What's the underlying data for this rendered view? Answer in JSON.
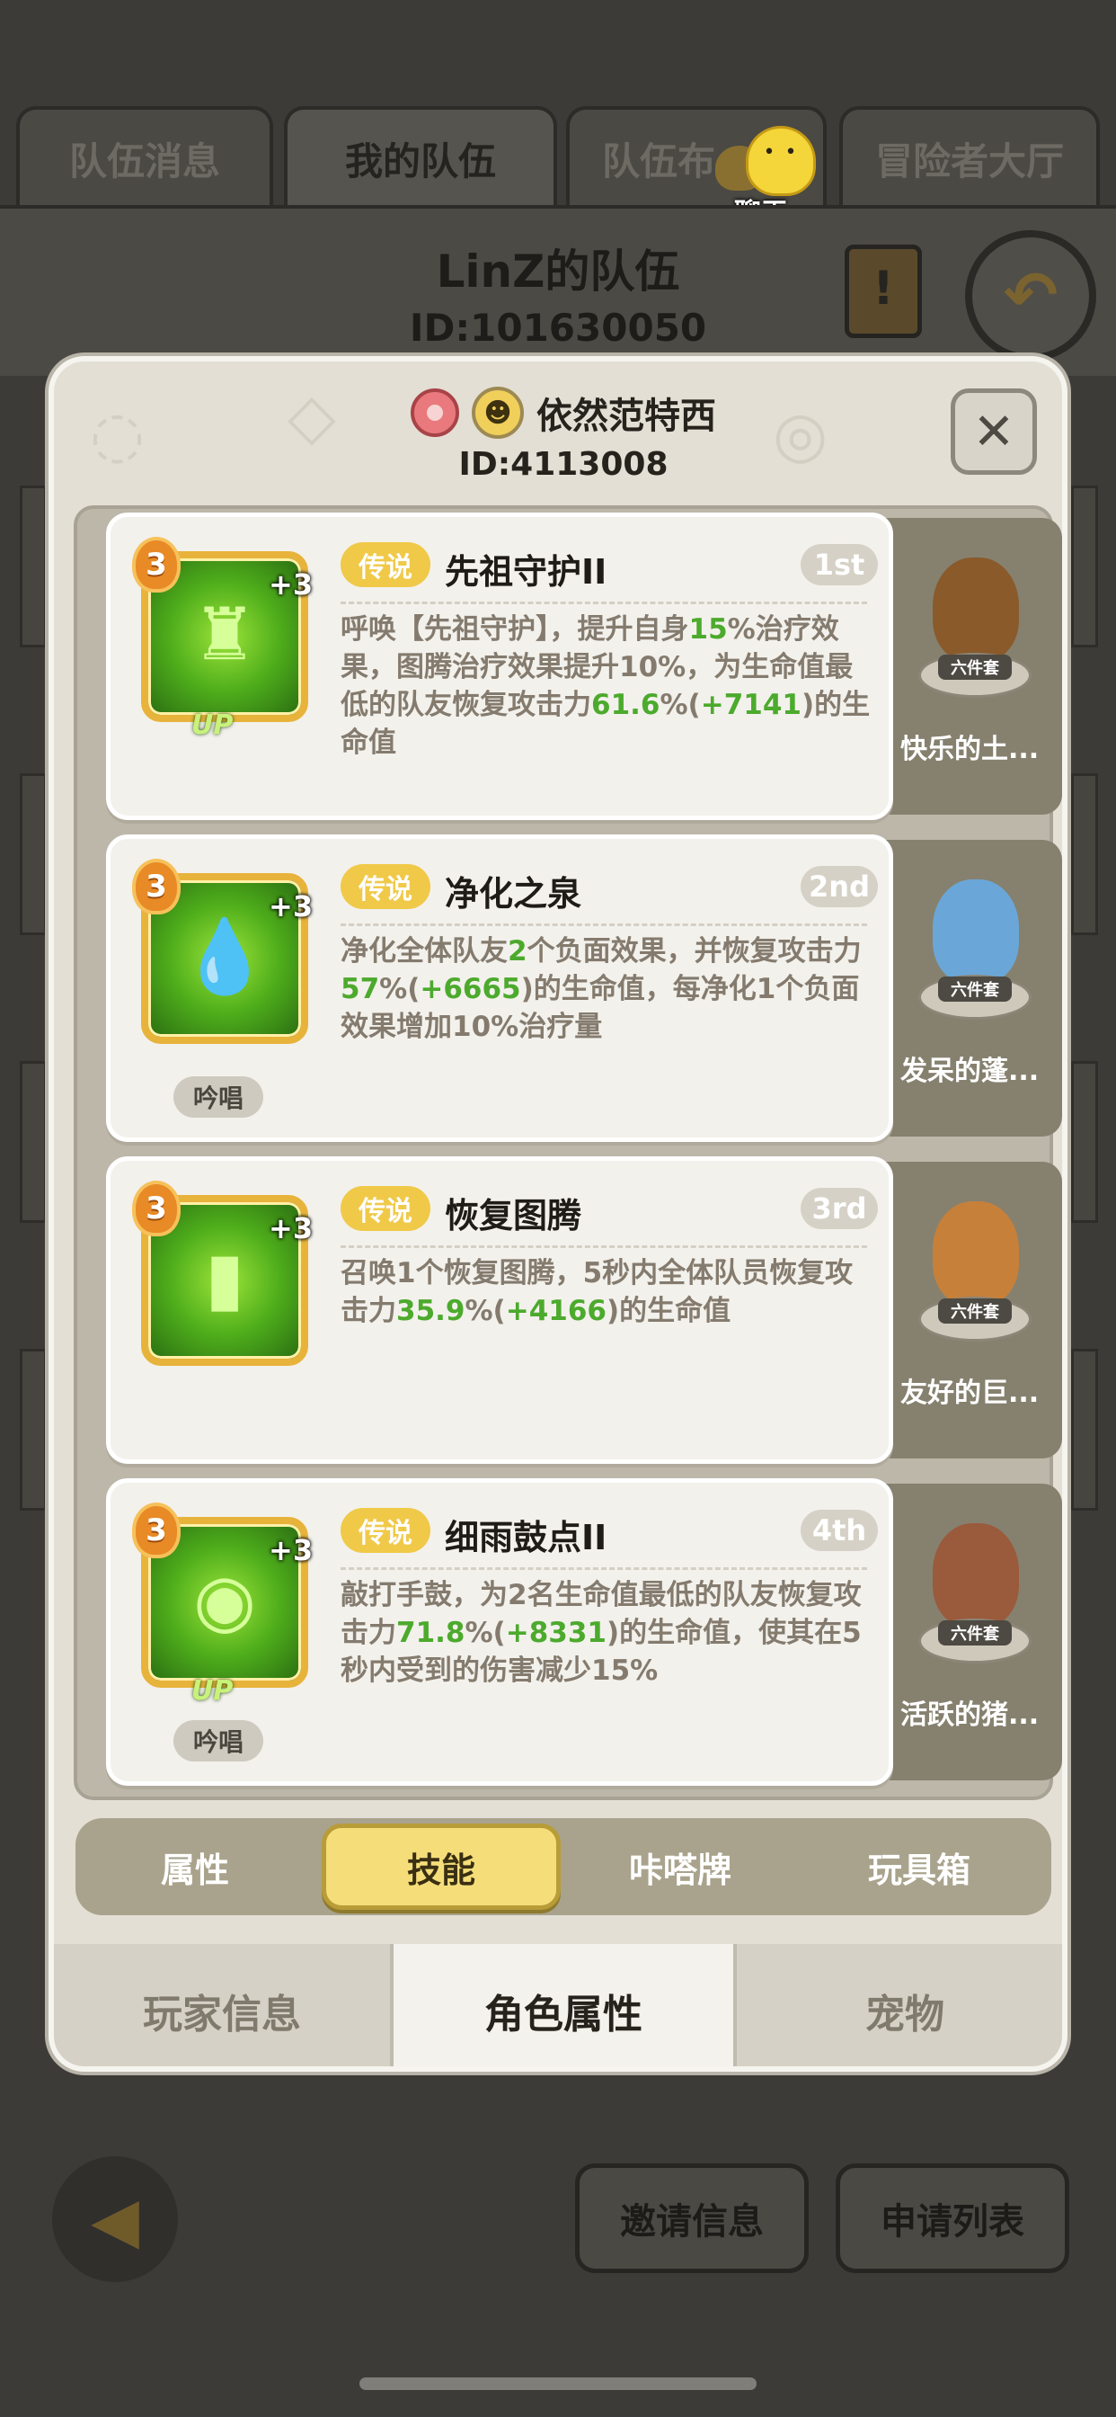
{
  "top_tabs": [
    "队伍消息",
    "我的队伍",
    "队伍布",
    "冒险者大厅"
  ],
  "chat": {
    "label": "聊天"
  },
  "team": {
    "name": "LinZ的队伍",
    "id": "ID:101630050"
  },
  "player": {
    "name": "依然范特西",
    "id": "ID:4113008",
    "close": "✕"
  },
  "skills": [
    {
      "level": "3",
      "plus": "+3",
      "up": "UP",
      "rarity": "传说",
      "title": "先祖守护II",
      "rank": "1st",
      "desc_parts": [
        "呼唤【先祖守护】，提升自身",
        "15",
        "%治疗效果，图腾治疗效果提升10%，为生命值最低的队友恢复攻击力",
        "61.6",
        "%(",
        "+7141",
        ")的生命值"
      ],
      "chant": ""
    },
    {
      "level": "3",
      "plus": "+3",
      "up": "",
      "rarity": "传说",
      "title": "净化之泉",
      "rank": "2nd",
      "desc_parts": [
        "净化全体队友",
        "2",
        "个负面效果，并恢复攻击力",
        "57",
        "%(",
        "+6665",
        ")的生命值，每净化1个负面效果增加10%治疗量"
      ],
      "chant": "吟唱"
    },
    {
      "level": "3",
      "plus": "+3",
      "up": "",
      "rarity": "传说",
      "title": "恢复图腾",
      "rank": "3rd",
      "desc_parts": [
        "召唤1个恢复图腾，5秒内全体队员恢复攻击力",
        "35.9",
        "%(",
        "+4166",
        ")的生命值"
      ],
      "chant": ""
    },
    {
      "level": "3",
      "plus": "+3",
      "up": "UP",
      "rarity": "传说",
      "title": "细雨鼓点II",
      "rank": "4th",
      "desc_parts": [
        "敲打手鼓，为2名生命值最低的队友恢复攻击力",
        "71.8",
        "%(",
        "+8331",
        ")的生命值，使其在5秒内受到的伤害减少15%"
      ],
      "chant": "吟唱"
    }
  ],
  "pets": [
    {
      "name": "快乐的土...",
      "set": "六件套",
      "color": "#8a5a2b"
    },
    {
      "name": "发呆的蓬...",
      "set": "六件套",
      "color": "#6aa7d8"
    },
    {
      "name": "友好的巨...",
      "set": "六件套",
      "color": "#c7803a"
    },
    {
      "name": "活跃的猪...",
      "set": "六件套",
      "color": "#9a5a3c"
    }
  ],
  "subtabs": [
    "属性",
    "技能",
    "咔嗒牌",
    "玩具箱"
  ],
  "bottom_tabs": [
    "玩家信息",
    "角色属性",
    "宠物"
  ],
  "buttons": {
    "invite": "邀请信息",
    "apply": "申请列表"
  },
  "colors": {
    "highlight": "#4caa2d",
    "rarity": "#f0c948",
    "active_subtab": "#f5de7a"
  },
  "icons": [
    "key-icon",
    "avatar-icon",
    "close-icon",
    "scroll-icon",
    "return-icon",
    "back-arrow-icon",
    "chat-icon"
  ]
}
